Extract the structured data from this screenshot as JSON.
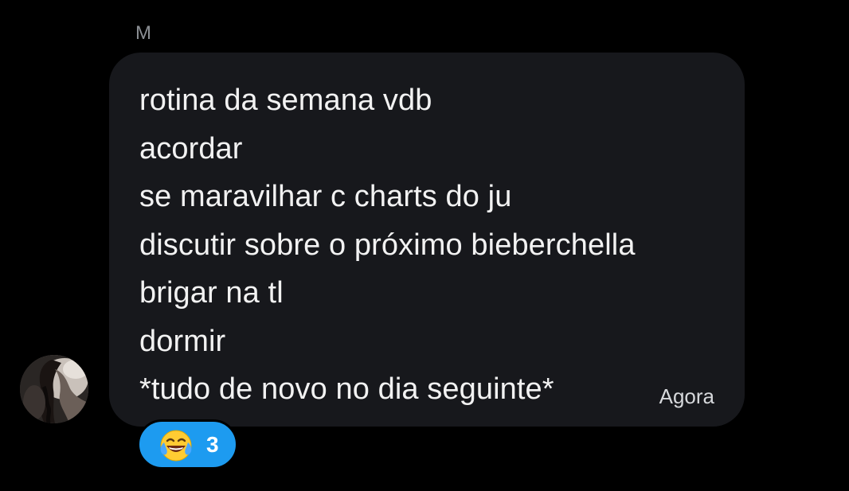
{
  "sender": {
    "initial": "M"
  },
  "message": {
    "lines": [
      "rotina da semana vdb",
      "acordar",
      "se maravilhar c charts do ju",
      "discutir sobre o próximo bieberchella",
      "brigar na tl",
      "dormir",
      "*tudo de novo no dia seguinte*"
    ],
    "timestamp": "Agora"
  },
  "reaction": {
    "emoji_icon": "tears-of-joy-emoji",
    "count": "3"
  },
  "colors": {
    "background": "#000000",
    "bubble": "#17181c",
    "reaction_pill": "#1d9bf0",
    "text": "#f2f2f2",
    "muted_text": "#8b8f94"
  }
}
